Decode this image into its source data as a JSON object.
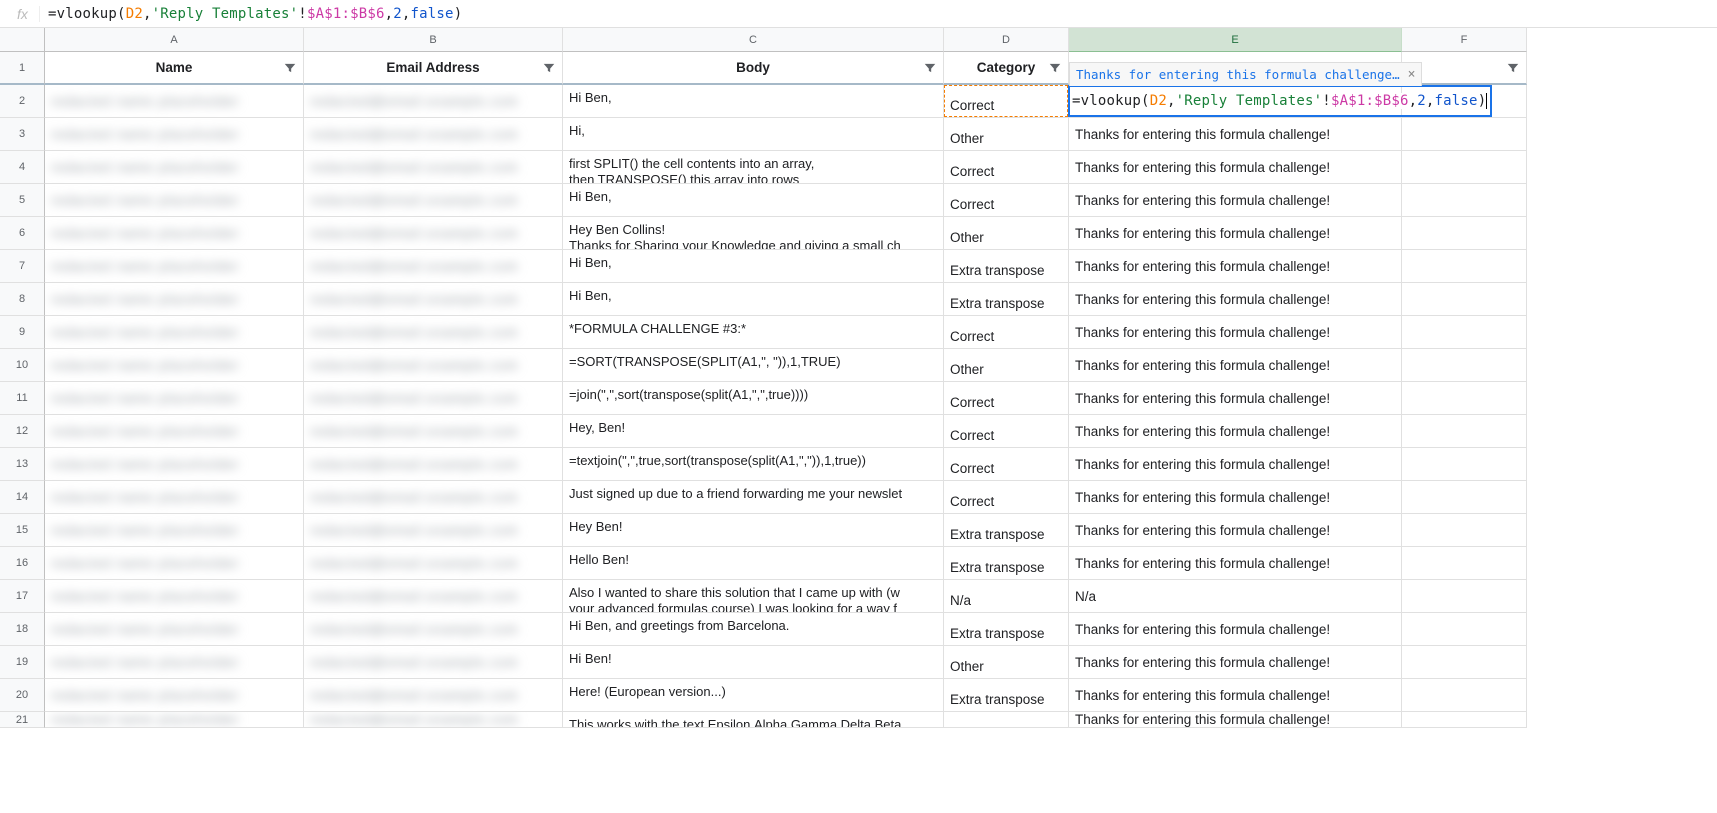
{
  "formula_bar": {
    "fx": "fx",
    "formula_plain": "=vlookup(D2,'Reply Templates'!$A$1:$B$6,2,false)"
  },
  "edit_cell": {
    "tooltip": "Thanks for entering this formula challenge…",
    "formula_plain": "=vlookup(D2,'Reply Templates'!$A$1:$B$6,2,false)"
  },
  "columns": [
    "A",
    "B",
    "C",
    "D",
    "E",
    "F"
  ],
  "headers": {
    "A": "Name",
    "B": "Email Address",
    "C": "Body",
    "D": "Category",
    "E": "",
    "F": ""
  },
  "rows": [
    {
      "n": 2,
      "body": "Hi Ben,",
      "sub": "",
      "cat": "Correct",
      "e": ""
    },
    {
      "n": 3,
      "body": "Hi,",
      "sub": "",
      "cat": "Other",
      "e": "Thanks for entering this formula challenge!"
    },
    {
      "n": 4,
      "body": "first SPLIT() the cell contents into an array,",
      "sub": "then TRANSPOSE() this array into rows",
      "cat": "Correct",
      "e": "Thanks for entering this formula challenge!"
    },
    {
      "n": 5,
      "body": "Hi Ben,",
      "sub": "",
      "cat": "Correct",
      "e": "Thanks for entering this formula challenge!"
    },
    {
      "n": 6,
      "body": "Hey Ben Collins!",
      "sub": "Thanks for Sharing your Knowledge and giving a small ch",
      "cat": "Other",
      "e": "Thanks for entering this formula challenge!"
    },
    {
      "n": 7,
      "body": "Hi Ben,",
      "sub": "",
      "cat": "Extra transpose",
      "e": "Thanks for entering this formula challenge!"
    },
    {
      "n": 8,
      "body": "Hi Ben,",
      "sub": "",
      "cat": "Extra transpose",
      "e": "Thanks for entering this formula challenge!"
    },
    {
      "n": 9,
      "body": "*FORMULA CHALLENGE #3:*",
      "sub": "",
      "cat": "Correct",
      "e": "Thanks for entering this formula challenge!"
    },
    {
      "n": 10,
      "body": "=SORT(TRANSPOSE(SPLIT(A1,\", \")),1,TRUE)",
      "sub": "",
      "cat": "Other",
      "e": "Thanks for entering this formula challenge!"
    },
    {
      "n": 11,
      "body": "=join(\",\",sort(transpose(split(A1,\",\",true))))",
      "sub": "",
      "cat": "Correct",
      "e": "Thanks for entering this formula challenge!"
    },
    {
      "n": 12,
      "body": "Hey, Ben!",
      "sub": "",
      "cat": "Correct",
      "e": "Thanks for entering this formula challenge!"
    },
    {
      "n": 13,
      "body": "=textjoin(\",\",true,sort(transpose(split(A1,\",\")),1,true))",
      "sub": "",
      "cat": "Correct",
      "e": "Thanks for entering this formula challenge!"
    },
    {
      "n": 14,
      "body": "Just signed up due to a friend forwarding me your newslet",
      "sub": "",
      "cat": "Correct",
      "e": "Thanks for entering this formula challenge!"
    },
    {
      "n": 15,
      "body": "Hey Ben!",
      "sub": "",
      "cat": "Extra transpose",
      "e": "Thanks for entering this formula challenge!"
    },
    {
      "n": 16,
      "body": "Hello Ben!",
      "sub": "",
      "cat": "Extra transpose",
      "e": "Thanks for entering this formula challenge!"
    },
    {
      "n": 17,
      "body": "Also I wanted to share this solution that I came up with (w",
      "sub": "your advanced formulas course)  I was looking for a way f",
      "cat": "N/a",
      "e": "N/a"
    },
    {
      "n": 18,
      "body": "Hi Ben, and greetings from Barcelona.",
      "sub": "",
      "cat": "Extra transpose",
      "e": "Thanks for entering this formula challenge!"
    },
    {
      "n": 19,
      "body": "Hi Ben!",
      "sub": "",
      "cat": "Other",
      "e": "Thanks for entering this formula challenge!"
    },
    {
      "n": 20,
      "body": "Here! (European version...)",
      "sub": "",
      "cat": "Extra transpose",
      "e": "Thanks for entering this formula challenge!"
    },
    {
      "n": 21,
      "body": "This works with the text Epsilon,Alpha,Gamma,Delta,Beta",
      "sub": "",
      "cat": "",
      "e": "Thanks for entering this formula challenge!"
    }
  ],
  "row_numbers_header": 1
}
